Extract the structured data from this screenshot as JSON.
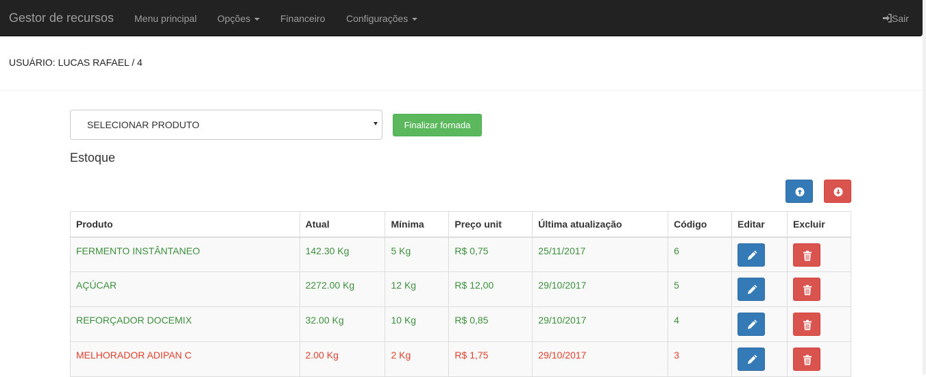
{
  "navbar": {
    "brand": "Gestor de recursos",
    "items": [
      {
        "label": "Menu principal",
        "dropdown": false
      },
      {
        "label": "Opções",
        "dropdown": true
      },
      {
        "label": "Financeiro",
        "dropdown": false
      },
      {
        "label": "Configurações",
        "dropdown": true
      }
    ],
    "logout": {
      "label": "Sair",
      "icon": "log-in-icon"
    }
  },
  "user": {
    "label": "USUÁRIO: LUCAS RAFAEL / 4"
  },
  "controls": {
    "product_select": "SELECIONAR PRODUTO",
    "finalize_button": "Finalizar fornada"
  },
  "stock": {
    "title": "Estoque",
    "upload_icon": "circle-arrow-up-icon",
    "download_icon": "circle-arrow-down-icon",
    "columns": [
      "Produto",
      "Atual",
      "Mínima",
      "Preço unit",
      "Última atualização",
      "Código",
      "Editar",
      "Excluir"
    ],
    "rows": [
      {
        "produto": "FERMENTO INSTÂNTANEO",
        "atual": "142.30 Kg",
        "minima": "5 Kg",
        "preco": "R$ 0,75",
        "atualizacao": "25/11/2017",
        "codigo": "6",
        "status": "ok"
      },
      {
        "produto": "AÇÚCAR",
        "atual": "2272.00 Kg",
        "minima": "12 Kg",
        "preco": "R$ 12,00",
        "atualizacao": "29/10/2017",
        "codigo": "5",
        "status": "ok"
      },
      {
        "produto": "REFORÇADOR DOCEMIX",
        "atual": "32.00 Kg",
        "minima": "10 Kg",
        "preco": "R$ 0,85",
        "atualizacao": "29/10/2017",
        "codigo": "4",
        "status": "ok"
      },
      {
        "produto": "MELHORADOR ADIPAN C",
        "atual": "2.00 Kg",
        "minima": "2 Kg",
        "preco": "R$ 1,75",
        "atualizacao": "29/10/2017",
        "codigo": "3",
        "status": "low"
      }
    ]
  },
  "colors": {
    "navbar_bg": "#222222",
    "ok_text": "#3c8f3c",
    "low_text": "#e0412d",
    "primary": "#337ab7",
    "danger": "#d9534f",
    "success": "#5cb85c"
  }
}
